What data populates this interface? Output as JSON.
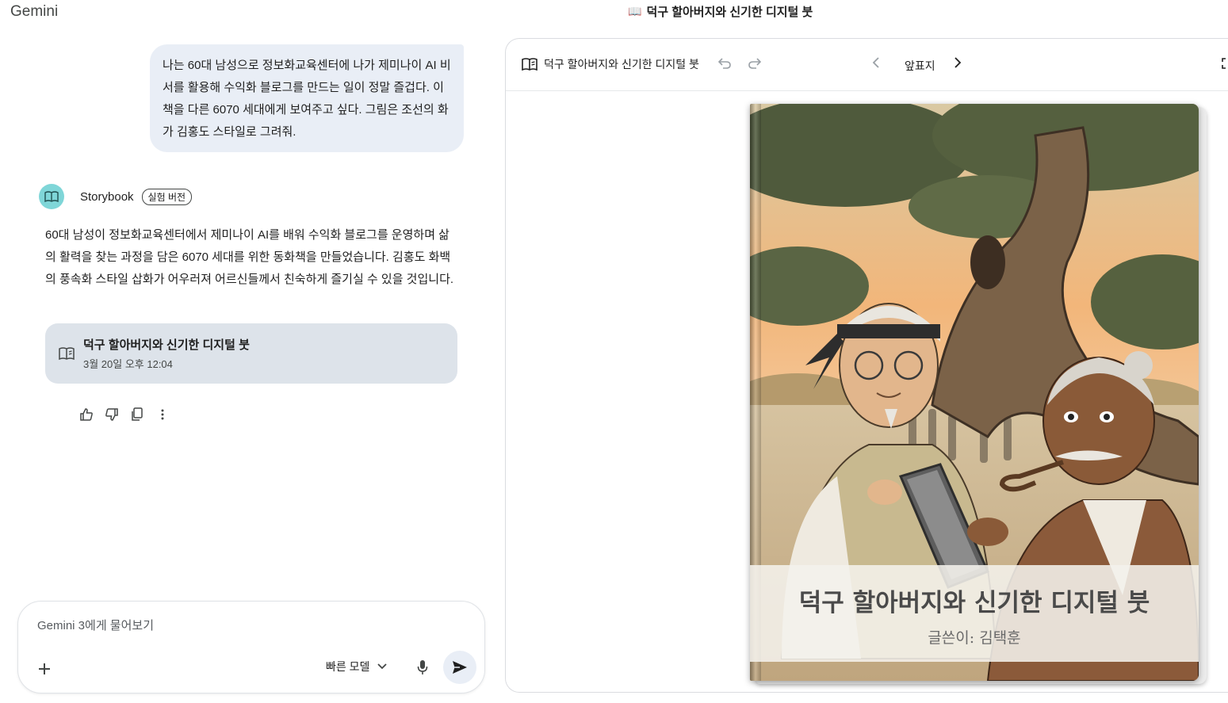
{
  "app": {
    "title": "Gemini"
  },
  "window": {
    "title": "덕구 할아버지와 신기한 디지털 붓"
  },
  "chat": {
    "user_message": "나는 60대 남성으로 정보화교육센터에 나가 제미나이 AI 비서를 활용해 수익화 블로그를 만드는 일이 정말 즐겁다. 이 책을 다른 6070 세대에게 보여주고 싶다. 그림은 조선의 화가 김홍도 스타일로 그려줘.",
    "agent_name": "Storybook",
    "agent_badge": "실험 버전",
    "response": "60대 남성이 정보화교육센터에서 제미나이 AI를 배워 수익화 블로그를 운영하며 삶의 활력을 찾는 과정을 담은 6070 세대를 위한 동화책을 만들었습니다. 김홍도 화백의 풍속화 스타일 삽화가 어우러져 어르신들께서 친숙하게 즐기실 수 있을 것입니다.",
    "card": {
      "title": "덕구 할아버지와 신기한 디지털 붓",
      "date": "3월 20일 오후 12:04"
    },
    "actions": [
      "thumbs-up",
      "thumbs-down",
      "copy",
      "more"
    ]
  },
  "composer": {
    "placeholder": "Gemini 3에게 물어보기",
    "model_label": "빠른 모델"
  },
  "viewer": {
    "title": "덕구 할아버지와 신기한 디지털 붓",
    "page_label": "앞표지",
    "cover_title": "덕구 할아버지와 신기한 디지털 붓",
    "cover_author": "글쓴이: 김택훈"
  },
  "colors": {
    "accent": "#7fd6d8",
    "bubble": "#e9eef6",
    "card": "#dde3ea"
  }
}
